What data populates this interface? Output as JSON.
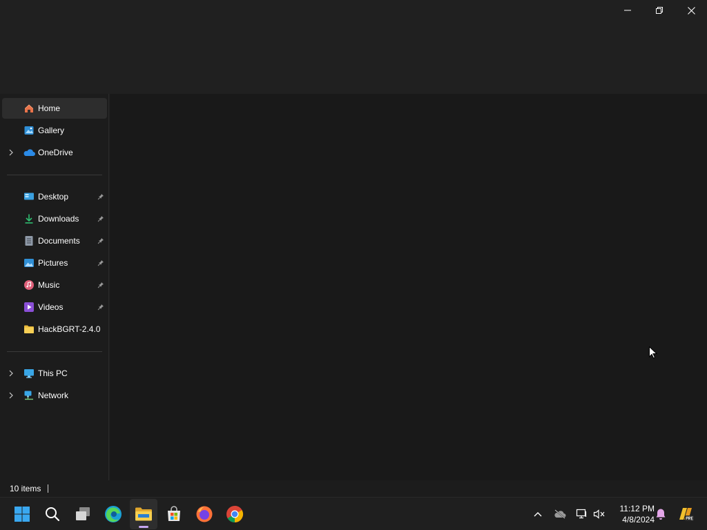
{
  "window": {
    "controls": {
      "minimize_icon": "minimize-icon",
      "maximize_icon": "restore-icon",
      "close_icon": "close-icon"
    }
  },
  "nav": {
    "items": [
      {
        "label": "Home",
        "icon": "home-icon",
        "selected": true
      },
      {
        "label": "Gallery",
        "icon": "gallery-icon"
      },
      {
        "label": "OneDrive",
        "icon": "onedrive-cloud-icon",
        "expandable": true
      },
      {
        "label": "Desktop",
        "icon": "desktop-icon",
        "pinned": true
      },
      {
        "label": "Downloads",
        "icon": "download-icon",
        "pinned": true
      },
      {
        "label": "Documents",
        "icon": "documents-icon",
        "pinned": true
      },
      {
        "label": "Pictures",
        "icon": "pictures-icon",
        "pinned": true
      },
      {
        "label": "Music",
        "icon": "music-icon",
        "pinned": true
      },
      {
        "label": "Videos",
        "icon": "videos-icon",
        "pinned": true
      },
      {
        "label": "HackBGRT-2.4.0",
        "icon": "folder-icon"
      },
      {
        "label": "This PC",
        "icon": "this-pc-icon",
        "expandable": true
      },
      {
        "label": "Network",
        "icon": "network-icon",
        "expandable": true
      }
    ]
  },
  "status": {
    "item_count": "10 items"
  },
  "taskbar": {
    "apps": [
      "start-icon",
      "search-icon",
      "task-view-icon",
      "edge-icon",
      "file-explorer-icon",
      "store-icon",
      "firefox-icon",
      "chrome-icon"
    ],
    "active_app": "file-explorer-icon",
    "tray": [
      "chevron-up-icon",
      "onedrive-offline-icon",
      "network-status-icon",
      "volume-muted-icon"
    ],
    "clock": {
      "time": "11:12 PM",
      "date": "4/8/2024"
    }
  },
  "colors": {
    "background": "#202020",
    "content": "#191919",
    "navpane": "#1c1c1c",
    "selected": "#2d2d2d",
    "taskbar": "#1f1f1f",
    "accent": "#c5a6f0"
  }
}
